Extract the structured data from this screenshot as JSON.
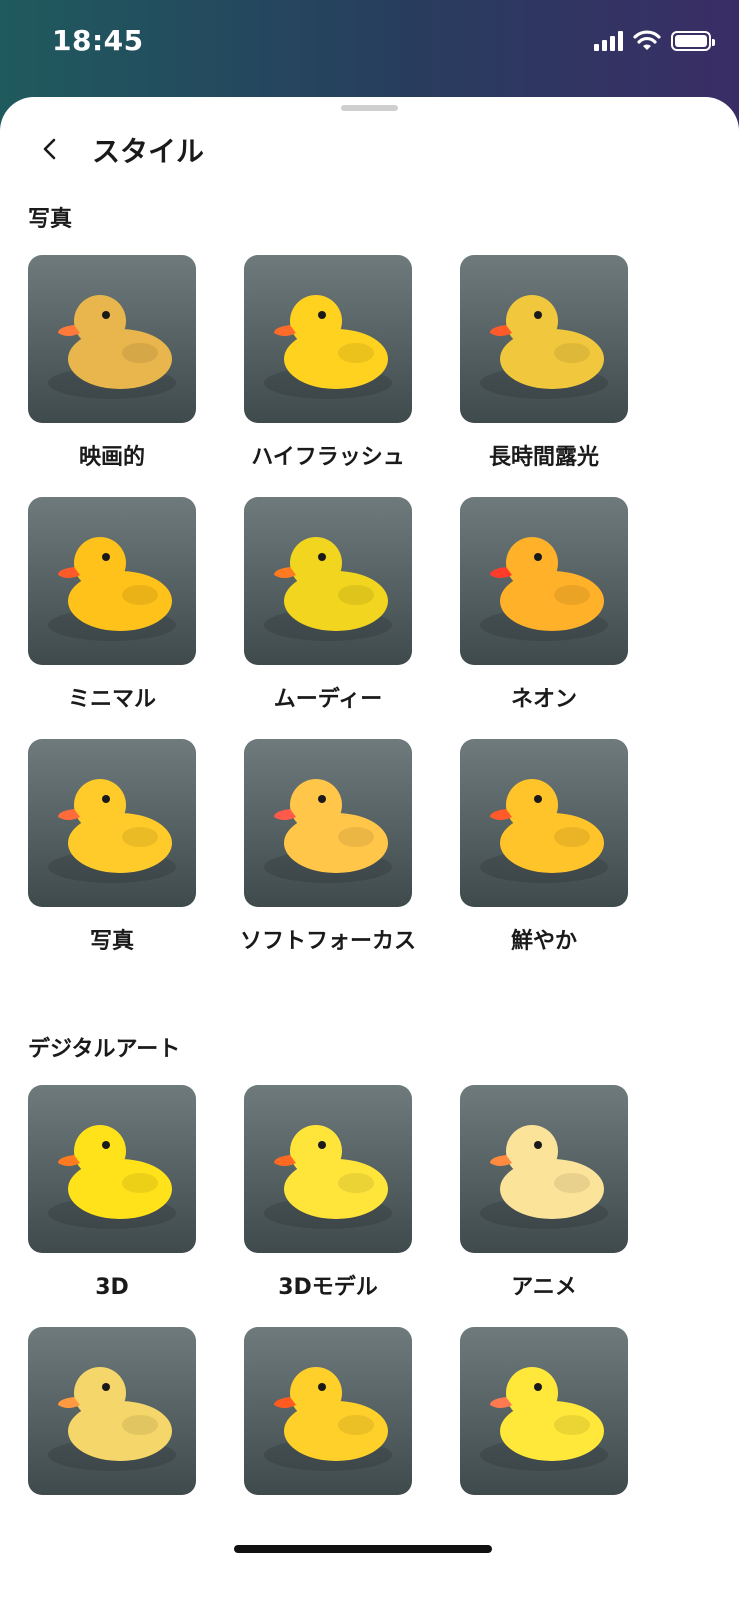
{
  "status_bar": {
    "time": "18:45"
  },
  "header": {
    "title": "スタイル"
  },
  "sections": [
    {
      "title": "写真",
      "items": [
        {
          "label": "映画的",
          "bg": "#6e7a7c",
          "bg2": "#3f4a4c",
          "duck": "#e8b64c",
          "accent": "#ff7a3a"
        },
        {
          "label": "ハイフラッシュ",
          "bg": "#e9eef2",
          "bg2": "#ffffff",
          "duck": "#ffd21f",
          "accent": "#ff6b2a"
        },
        {
          "label": "長時間露光",
          "bg": "#b8b6ac",
          "bg2": "#d6d3c8",
          "duck": "#f1c83d",
          "accent": "#ff5b2a"
        },
        {
          "label": "ミニマル",
          "bg": "#e3e0dc",
          "bg2": "#f3f1ee",
          "duck": "#ffc21a",
          "accent": "#ff5a2a"
        },
        {
          "label": "ムーディー",
          "bg": "#1d2a15",
          "bg2": "#0a0f07",
          "duck": "#f2d51e",
          "accent": "#ff7a20"
        },
        {
          "label": "ネオン",
          "bg": "#3b0f57",
          "bg2": "#a1206a",
          "duck": "#ffb12a",
          "accent": "#ff3b2a"
        },
        {
          "label": "写真",
          "bg": "#dfe9e6",
          "bg2": "#9ad1c9",
          "duck": "#ffcb2a",
          "accent": "#ff6b3a"
        },
        {
          "label": "ソフトフォーカス",
          "bg": "#b7b172",
          "bg2": "#e9e4c6",
          "duck": "#ffc64a",
          "accent": "#ff5a4a"
        },
        {
          "label": "鮮やか",
          "bg": "#ff9bc5",
          "bg2": "#ffd1e3",
          "duck": "#ffc42a",
          "accent": "#ff5a2a"
        }
      ]
    },
    {
      "title": "デジタルアート",
      "items": [
        {
          "label": "3D",
          "bg": "#4f9e3a",
          "bg2": "#9fd16a",
          "duck": "#ffe21a",
          "accent": "#ff7a20"
        },
        {
          "label": "3Dモデル",
          "bg": "#e6e7ea",
          "bg2": "#f4f4f6",
          "duck": "#ffe43a",
          "accent": "#ff6a20"
        },
        {
          "label": "アニメ",
          "bg": "#f7c9d8",
          "bg2": "#c8dff2",
          "duck": "#fbe39a",
          "accent": "#ff8a40"
        },
        {
          "label": "",
          "bg": "#e3cd93",
          "bg2": "#b9c9c8",
          "duck": "#f5d66a",
          "accent": "#ff9a40"
        },
        {
          "label": "",
          "bg": "#2a3f7a",
          "bg2": "#e77fb5",
          "duck": "#ffd02a",
          "accent": "#ff5a20"
        },
        {
          "label": "",
          "bg": "#d4c8b2",
          "bg2": "#c9b3e6",
          "duck": "#ffe83a",
          "accent": "#ff7a50"
        }
      ]
    }
  ]
}
